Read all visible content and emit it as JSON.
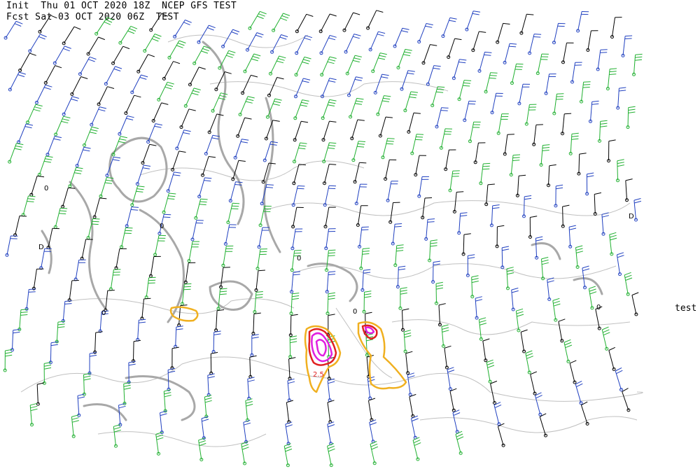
{
  "header": {
    "line1": "Init  Thu 01 OCT 2020 18Z  NCEP GFS TEST",
    "line2": "Fcst Sat 03 OCT 2020 06Z  TEST"
  },
  "side_label": "test",
  "contour_labels": [
    "2.5",
    "0",
    "D",
    "0",
    "0",
    "0",
    "D",
    "0",
    "0"
  ],
  "colors": {
    "background": "#ffffff",
    "coastline": "#c0c0c0",
    "gray_contour": "#a8a8a8",
    "barb_black": "#000000",
    "barb_blue": "#2040c0",
    "barb_green": "#20b030",
    "contour_yellow": "#f0b020",
    "contour_red": "#e02020",
    "contour_magenta": "#e020e0"
  }
}
